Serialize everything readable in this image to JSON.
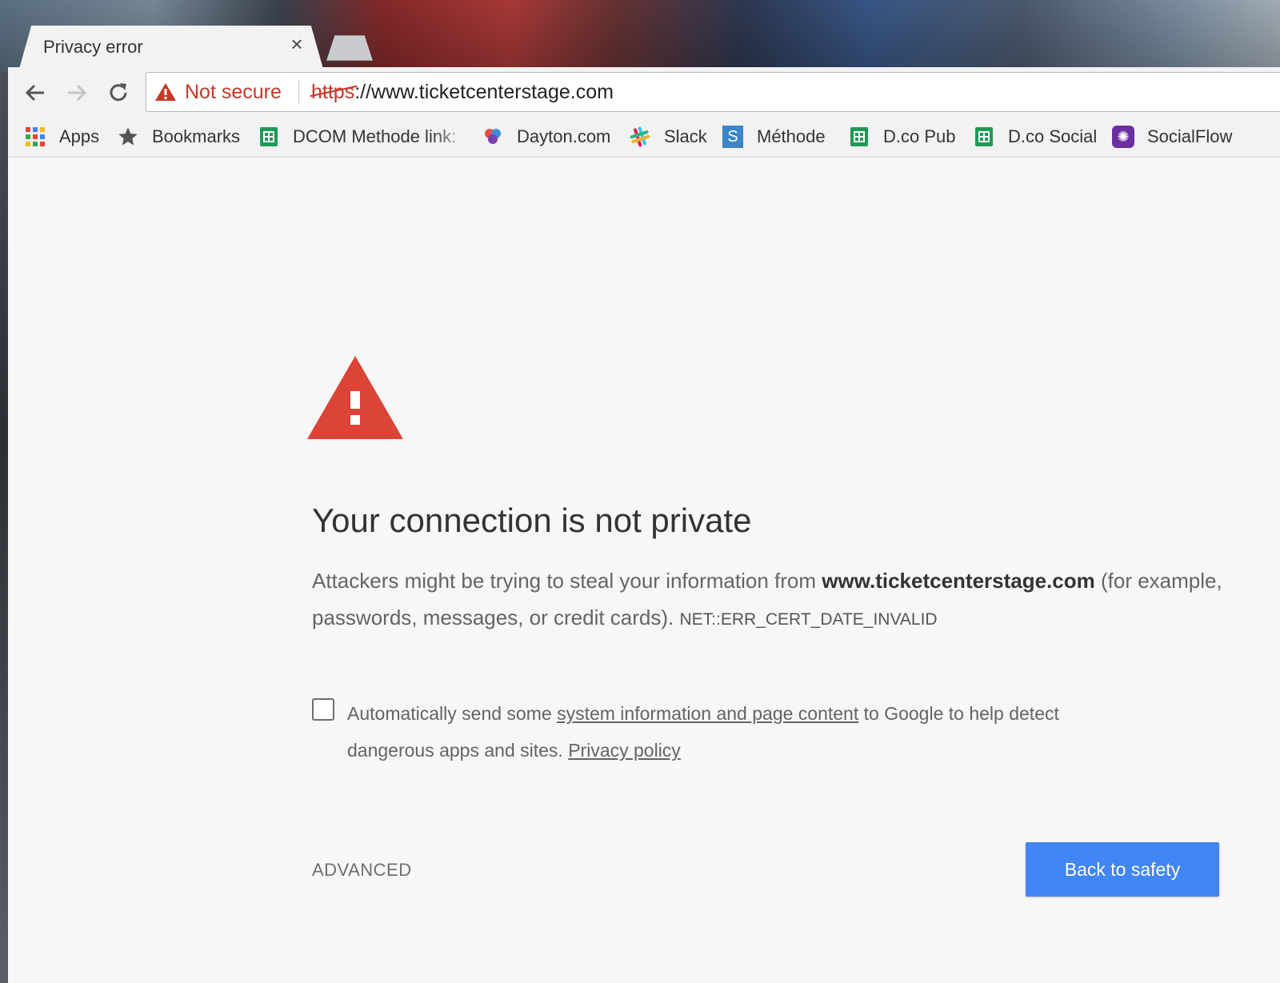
{
  "browser": {
    "tab": {
      "title": "Privacy error",
      "close": "×"
    },
    "omnibox": {
      "security_label": "Not secure",
      "url_scheme": "https",
      "url_rest": "://www.ticketcenterstage.com"
    },
    "bookmarks": [
      {
        "label": "Apps",
        "icon": "apps-grid-icon"
      },
      {
        "label": "Bookmarks",
        "icon": "star-icon"
      },
      {
        "label": "DCOM Methode link:",
        "icon": "sheets-icon"
      },
      {
        "label": "Dayton.com",
        "icon": "dayton-icon"
      },
      {
        "label": "Slack",
        "icon": "slack-icon"
      },
      {
        "label": "Méthode",
        "icon": "s-icon"
      },
      {
        "label": "D.co Pub",
        "icon": "sheets-icon"
      },
      {
        "label": "D.co Social",
        "icon": "sheets-icon"
      },
      {
        "label": "SocialFlow",
        "icon": "socialflow-icon"
      }
    ]
  },
  "interstitial": {
    "heading": "Your connection is not private",
    "para_prefix": "Attackers might be trying to steal your information from ",
    "para_host": "www.ticketcenterstage.com",
    "para_suffix": " (for example, passwords, messages, or credit cards). ",
    "error_code": "NET::ERR_CERT_DATE_INVALID",
    "optin_prefix": "Automatically send some ",
    "optin_link": "system information and page content",
    "optin_middle": " to Google to help detect dangerous apps and sites. ",
    "privacy_link": "Privacy policy",
    "advanced_label": "ADVANCED",
    "back_button": "Back to safety"
  },
  "colors": {
    "warning_red": "#db4437",
    "not_secure_red": "#c5392a",
    "primary_button": "#4285f4",
    "page_bg": "#f7f7f7"
  }
}
